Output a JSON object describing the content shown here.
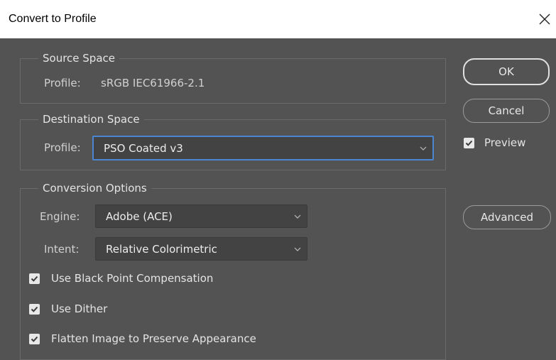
{
  "window": {
    "title": "Convert to Profile",
    "close_glyph": "×",
    "close_icon": "close-icon"
  },
  "source_space": {
    "legend": "Source Space",
    "profile_label": "Profile:",
    "profile_value": "sRGB IEC61966-2.1"
  },
  "destination_space": {
    "legend": "Destination Space",
    "profile_label": "Profile:",
    "profile_value": "PSO Coated v3"
  },
  "conversion_options": {
    "legend": "Conversion Options",
    "engine_label": "Engine:",
    "engine_value": "Adobe (ACE)",
    "intent_label": "Intent:",
    "intent_value": "Relative Colorimetric",
    "options": [
      {
        "label": "Use Black Point Compensation",
        "checked": true
      },
      {
        "label": "Use Dither",
        "checked": true
      },
      {
        "label": "Flatten Image to Preserve Appearance",
        "checked": true
      }
    ]
  },
  "buttons": {
    "ok": "OK",
    "cancel": "Cancel",
    "advanced": "Advanced"
  },
  "preview": {
    "label": "Preview",
    "checked": true
  },
  "colors": {
    "background": "#535353",
    "titlebar": "#ffffff",
    "focus_border": "#4b86d2",
    "select_bg": "#434343"
  }
}
